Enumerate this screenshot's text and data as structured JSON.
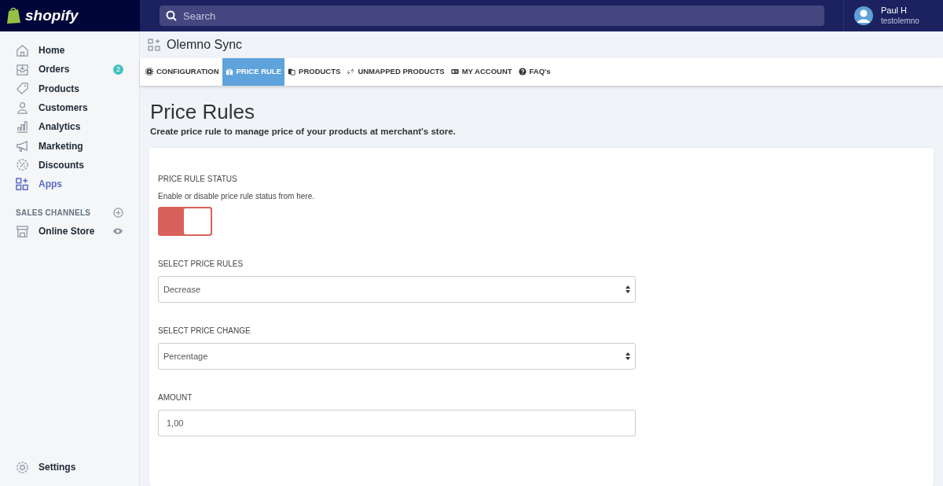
{
  "topbar": {
    "logo": "shopify",
    "search": {
      "placeholder": "Search"
    },
    "user": {
      "name": "Paul H",
      "store": "testolemno"
    }
  },
  "sidebar": {
    "items": [
      {
        "label": "Home",
        "selected": false
      },
      {
        "label": "Orders",
        "selected": false,
        "badge": "2"
      },
      {
        "label": "Products",
        "selected": false
      },
      {
        "label": "Customers",
        "selected": false
      },
      {
        "label": "Analytics",
        "selected": false
      },
      {
        "label": "Marketing",
        "selected": false
      },
      {
        "label": "Discounts",
        "selected": false
      },
      {
        "label": "Apps",
        "selected": true
      }
    ],
    "sales_channels": {
      "heading": "SALES CHANNELS",
      "items": [
        {
          "label": "Online Store"
        }
      ]
    },
    "settings": "Settings"
  },
  "app_title": "Olemno Sync",
  "tabs": [
    {
      "label": "CONFIGURATION",
      "selected": false
    },
    {
      "label": "PRICE RULE",
      "selected": true
    },
    {
      "label": "PRODUCTS",
      "selected": false
    },
    {
      "label": "UNMAPPED PRODUCTS",
      "selected": false
    },
    {
      "label": "MY ACCOUNT",
      "selected": false
    },
    {
      "label": "FAQ's",
      "selected": false
    }
  ],
  "page": {
    "title": "Price Rules",
    "subtitle": "Create price rule to manage price of your products at merchant's store."
  },
  "form": [
    {
      "kind": "toggle",
      "label": "PRICE RULE STATUS",
      "help": "Enable or disable price rule status from here.",
      "on": true
    },
    {
      "kind": "select",
      "label": "SELECT PRICE RULES",
      "value": "Decrease"
    },
    {
      "kind": "select",
      "label": "SELECT PRICE CHANGE",
      "value": "Percentage"
    },
    {
      "kind": "input",
      "label": "AMOUNT",
      "value": "1,00"
    }
  ]
}
